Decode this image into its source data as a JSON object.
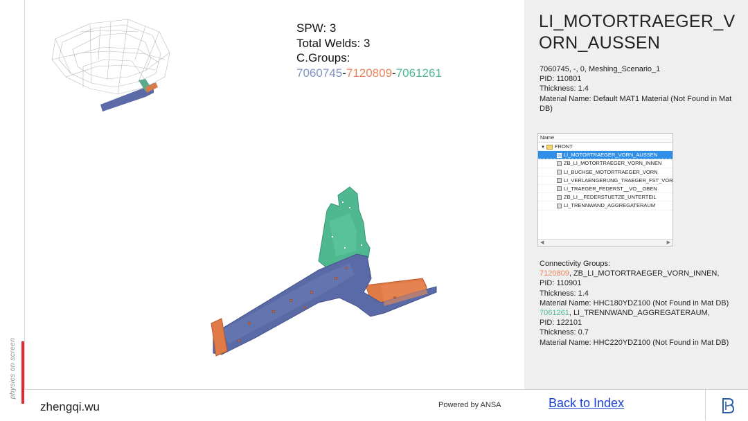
{
  "viewport": {
    "spw_label": "SPW: 3",
    "total_welds_label": "Total Welds: 3",
    "cgroups_label": "C.Groups:",
    "cgroups": [
      "7060745",
      "7120809",
      "7061261"
    ],
    "separator": "-",
    "colors": {
      "group0": "#7f93c0",
      "group1": "#e8845a",
      "group2": "#4dbb92"
    }
  },
  "sidebar_text": "physics on screen",
  "footer": {
    "author": "zhengqi.wu",
    "powered": "Powered by ANSA",
    "back_link": "Back to Index"
  },
  "part": {
    "title": "LI_MOTORTRAEGER_VORN_AUSSEN",
    "line1": "7060745, -, 0, Meshing_Scenario_1",
    "pid": "PID: 110801",
    "thickness": "Thickness: 1.4",
    "material": "Material Name: Default MAT1 Material (Not Found in Mat DB)"
  },
  "tree": {
    "header": "Name",
    "root": "FRONT",
    "items": [
      "LI_MOTORTRAEGER_VORN_AUSSEN",
      "ZB_LI_MOTORTRAEGER_VORN_INNEN",
      "LI_BUCHSE_MOTORTRAEGER_VORN",
      "LI_VERLAENGERUNG_TRAEGER_FST_VOR",
      "LI_TRAEGER_FEDERST__VO__OBEN",
      "ZB_LI__FEDERSTUETZE_UNTERTEIL",
      "LI_TRENNWAND_AGGREGATERAUM"
    ],
    "selected_index": 0
  },
  "connectivity": {
    "heading": "Connectivity Groups:",
    "groups": [
      {
        "id": "7120809",
        "name": ", ZB_LI_MOTORTRAEGER_VORN_INNEN,",
        "pid": "PID: 110901",
        "thickness": "Thickness: 1.4",
        "material": "Material Name: HHC180YDZ100 (Not Found in Mat DB)"
      },
      {
        "id": "7061261",
        "name": ", LI_TRENNWAND_AGGREGATERAUM,",
        "pid": "PID: 122101",
        "thickness": "Thickness: 0.7",
        "material": "Material Name: HHC220YDZ100 (Not Found in Mat DB)"
      }
    ]
  }
}
